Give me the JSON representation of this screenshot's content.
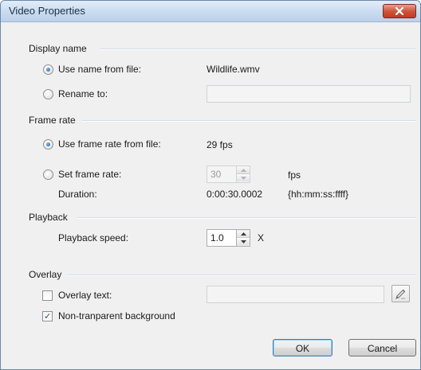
{
  "window": {
    "title": "Video Properties"
  },
  "display_name": {
    "group_label": "Display name",
    "use_name_label": "Use name from file:",
    "file_name": "Wildlife.wmv",
    "rename_label": "Rename to:",
    "rename_value": ""
  },
  "frame_rate": {
    "group_label": "Frame rate",
    "use_rate_label": "Use frame rate from file:",
    "file_rate": "29 fps",
    "set_rate_label": "Set frame rate:",
    "set_rate_value": "30",
    "set_rate_unit": "fps",
    "duration_label": "Duration:",
    "duration_value": "0:00:30.0002",
    "duration_format": "{hh:mm:ss:ffff}"
  },
  "playback": {
    "group_label": "Playback",
    "speed_label": "Playback speed:",
    "speed_value": "1.0",
    "speed_unit": "X"
  },
  "overlay": {
    "group_label": "Overlay",
    "overlay_text_label": "Overlay text:",
    "overlay_text_value": "",
    "overlay_text_checked": false,
    "non_transparent_label": "Non-tranparent background",
    "non_transparent_checked": true
  },
  "buttons": {
    "ok": "OK",
    "cancel": "Cancel"
  },
  "icons": {
    "close": "close-icon",
    "edit": "edit-pen-icon",
    "spin_up": "chevron-up-icon",
    "spin_down": "chevron-down-icon"
  }
}
